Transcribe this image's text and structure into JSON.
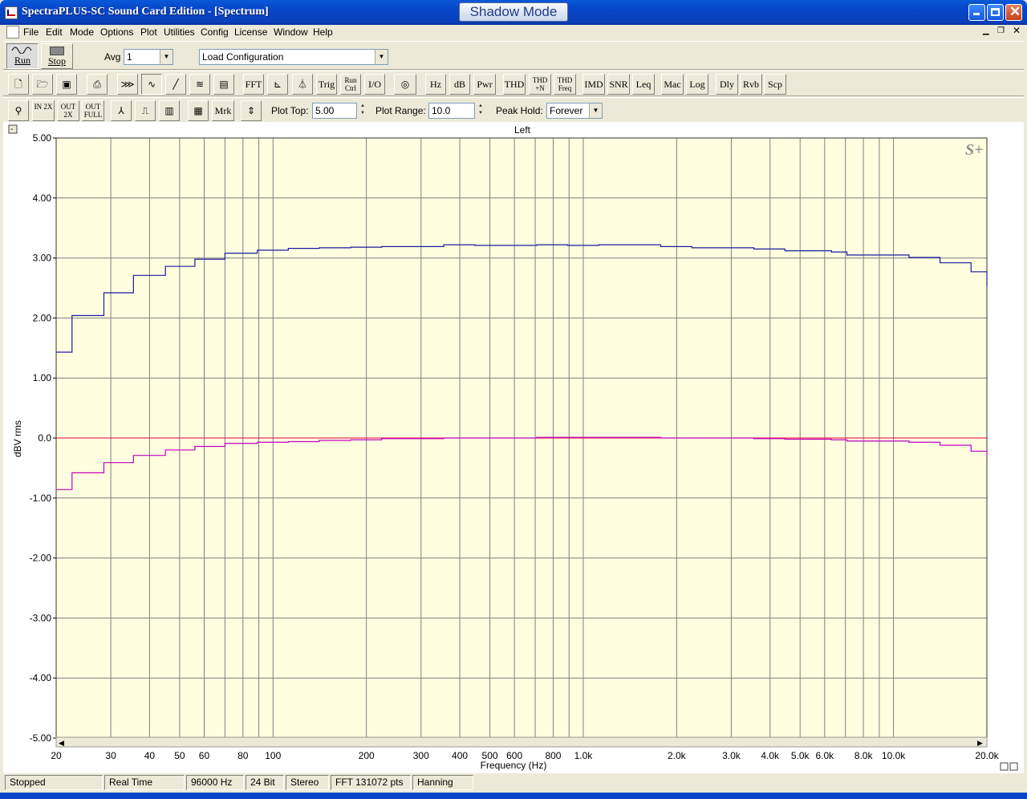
{
  "window": {
    "title": "SpectraPLUS-SC Sound Card Edition - [Spectrum]",
    "badge": "Shadow Mode"
  },
  "menu": [
    "File",
    "Edit",
    "Mode",
    "Options",
    "Plot",
    "Utilities",
    "Config",
    "License",
    "Window",
    "Help"
  ],
  "toolbar1": {
    "run": "Run",
    "stop": "Stop",
    "avg_label": "Avg",
    "avg_value": "1",
    "config_value": "Load Configuration"
  },
  "toolbar2": {
    "buttons": [
      "FFT",
      "Trig",
      "Run Ctrl",
      "I/O",
      "Hz",
      "dB",
      "Pwr",
      "THD",
      "THD +N",
      "THD Freq",
      "IMD",
      "SNR",
      "Leq",
      "Mac",
      "Log",
      "Dly",
      "Rvb",
      "Scp"
    ]
  },
  "toolbar3": {
    "zoom_in": "IN 2X",
    "zoom_out": "OUT 2X",
    "zoom_full": "OUT FULL",
    "marker": "Mrk",
    "plot_top_label": "Plot Top:",
    "plot_top_value": "5.00",
    "plot_range_label": "Plot Range:",
    "plot_range_value": "10.0",
    "peak_hold_label": "Peak Hold:",
    "peak_hold_value": "Forever"
  },
  "plot": {
    "channel": "Left",
    "logo": "S+",
    "bg_color": "#ffffe0",
    "grid_color": "#7f7f7f"
  },
  "chart_data": {
    "type": "line",
    "xscale": "log",
    "xlim": [
      20,
      20000
    ],
    "ylim": [
      -5,
      5
    ],
    "xlabel": "Frequency (Hz)",
    "ylabel": "dBV rms",
    "yticks": [
      "5.00",
      "4.00",
      "3.00",
      "2.00",
      "1.00",
      "0.0",
      "-1.00",
      "-2.00",
      "-3.00",
      "-4.00",
      "-5.00"
    ],
    "xticks": [
      {
        "v": 20,
        "l": "20"
      },
      {
        "v": 30,
        "l": "30"
      },
      {
        "v": 40,
        "l": "40"
      },
      {
        "v": 50,
        "l": "50"
      },
      {
        "v": 60,
        "l": "60"
      },
      {
        "v": 80,
        "l": "80"
      },
      {
        "v": 100,
        "l": "100"
      },
      {
        "v": 200,
        "l": "200"
      },
      {
        "v": 300,
        "l": "300"
      },
      {
        "v": 400,
        "l": "400"
      },
      {
        "v": 500,
        "l": "500"
      },
      {
        "v": 600,
        "l": "600"
      },
      {
        "v": 800,
        "l": "800"
      },
      {
        "v": 1000,
        "l": "1.0k"
      },
      {
        "v": 2000,
        "l": "2.0k"
      },
      {
        "v": 3000,
        "l": "3.0k"
      },
      {
        "v": 4000,
        "l": "4.0k"
      },
      {
        "v": 5000,
        "l": "5.0k"
      },
      {
        "v": 6000,
        "l": "6.0k"
      },
      {
        "v": 8000,
        "l": "8.0k"
      },
      {
        "v": 10000,
        "l": "10.0k"
      },
      {
        "v": 20000,
        "l": "20.0k"
      }
    ],
    "series": [
      {
        "color": "#1a1aa0",
        "step": true,
        "x": [
          20,
          22.5,
          28.5,
          35.5,
          45,
          56,
          70,
          89,
          112,
          141,
          178,
          224,
          355,
          447,
          708,
          891,
          1122,
          1778,
          2239,
          3548,
          4467,
          6310,
          7079,
          11220,
          14125,
          17783,
          20000
        ],
        "y": [
          1.43,
          2.04,
          2.42,
          2.71,
          2.86,
          2.98,
          3.08,
          3.13,
          3.16,
          3.17,
          3.18,
          3.19,
          3.22,
          3.21,
          3.22,
          3.21,
          3.22,
          3.19,
          3.17,
          3.15,
          3.12,
          3.1,
          3.05,
          3.01,
          2.92,
          2.77,
          2.54
        ]
      },
      {
        "color": "#c000c0",
        "step": true,
        "x": [
          20,
          22.5,
          28.5,
          35.5,
          45,
          56,
          70,
          89,
          112,
          141,
          178,
          224,
          355,
          447,
          708,
          891,
          1122,
          1778,
          2239,
          3548,
          4467,
          6310,
          7079,
          11220,
          14125,
          17783,
          20000
        ],
        "y": [
          -0.86,
          -0.58,
          -0.41,
          -0.29,
          -0.2,
          -0.14,
          -0.09,
          -0.07,
          -0.06,
          -0.04,
          -0.03,
          -0.01,
          0.0,
          0.0,
          0.01,
          0.01,
          0.01,
          0.0,
          0.0,
          -0.01,
          -0.02,
          -0.03,
          -0.05,
          -0.07,
          -0.12,
          -0.22,
          -0.31
        ]
      }
    ],
    "reference_line": {
      "y": 0.0,
      "color": "#e0003a"
    }
  },
  "status": [
    "Stopped",
    "Real Time",
    "96000 Hz",
    "24 Bit",
    "Stereo",
    "FFT 131072 pts",
    "Hanning"
  ]
}
